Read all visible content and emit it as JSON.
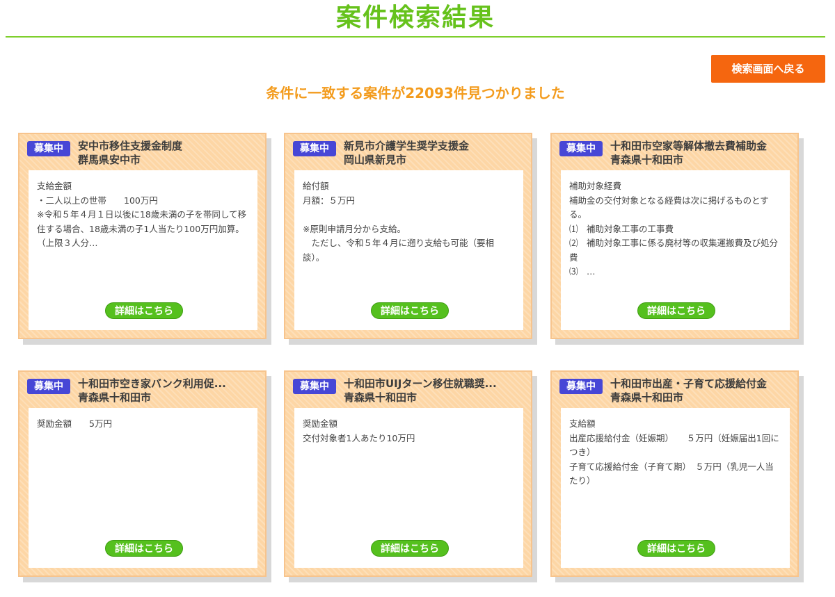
{
  "header": {
    "title": "案件検索結果",
    "back_button": "検索画面へ戻る",
    "result_text": "条件に一致する案件が22093件見つかりました"
  },
  "cards": [
    {
      "badge": "募集中",
      "title": "安中市移住支援金制度",
      "region": "群馬県安中市",
      "text": "支給金額\n・二人以上の世帯　　100万円\n※令和５年４月１日以後に18歳未満の子を帯同して移住する場合、18歳未満の子1人当たり100万円加算。（上限３人分…",
      "button": "詳細はこちら"
    },
    {
      "badge": "募集中",
      "title": "新見市介護学生奨学支援金",
      "region": "岡山県新見市",
      "text": "給付額\n月額：５万円\n\n※原則申請月分から支給。\n　ただし、令和５年４月に遡り支給も可能（要相談）。",
      "button": "詳細はこちら"
    },
    {
      "badge": "募集中",
      "title": "十和田市空家等解体撤去費補助金",
      "region": "青森県十和田市",
      "text": "補助対象経費\n補助金の交付対象となる経費は次に掲げるものとする。\n⑴　補助対象工事の工事費\n⑵　補助対象工事に係る廃材等の収集運搬費及び処分費\n⑶　…",
      "button": "詳細はこちら"
    },
    {
      "badge": "募集中",
      "title": "十和田市空き家バンク利用促...",
      "region": "青森県十和田市",
      "text": "奨励金額　　5万円",
      "button": "詳細はこちら"
    },
    {
      "badge": "募集中",
      "title": "十和田市UIJターン移住就職奨...",
      "region": "青森県十和田市",
      "text": "奨励金額\n交付対象者1人あたり10万円",
      "button": "詳細はこちら"
    },
    {
      "badge": "募集中",
      "title": "十和田市出産・子育て応援給付金",
      "region": "青森県十和田市",
      "text": "支給額\n出産応援給付金（妊娠期）　　５万円（妊娠届出1回につき）\n子育て応援給付金（子育て期）　５万円（乳児一人当たり）",
      "button": "詳細はこちら"
    }
  ]
}
